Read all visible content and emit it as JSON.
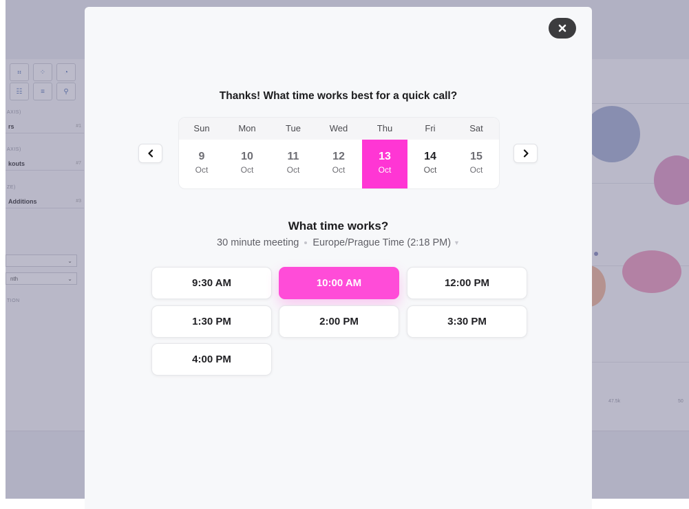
{
  "modal": {
    "close_icon": "close-icon",
    "prompt_title": "Thanks! What time works best for a quick call?",
    "calendar": {
      "prev_icon": "chevron-left-icon",
      "next_icon": "chevron-right-icon",
      "days": [
        {
          "dow": "Sun",
          "day": "9",
          "month": "Oct",
          "state": "unavailable"
        },
        {
          "dow": "Mon",
          "day": "10",
          "month": "Oct",
          "state": "unavailable"
        },
        {
          "dow": "Tue",
          "day": "11",
          "month": "Oct",
          "state": "unavailable"
        },
        {
          "dow": "Wed",
          "day": "12",
          "month": "Oct",
          "state": "unavailable"
        },
        {
          "dow": "Thu",
          "day": "13",
          "month": "Oct",
          "state": "selected"
        },
        {
          "dow": "Fri",
          "day": "14",
          "month": "Oct",
          "state": "available"
        },
        {
          "dow": "Sat",
          "day": "15",
          "month": "Oct",
          "state": "unavailable"
        }
      ]
    },
    "time_title": "What time works?",
    "meeting_length": "30 minute meeting",
    "timezone": "Europe/Prague Time (2:18 PM)",
    "time_slots": [
      "9:30 AM",
      "10:00 AM",
      "12:00 PM",
      "1:30 PM",
      "2:00 PM",
      "3:30 PM",
      "4:00 PM"
    ],
    "selected_slot": "10:00 AM",
    "accent_color": "#ff36d4"
  },
  "background": {
    "sidebar_fields": [
      {
        "label": "rs",
        "hotkey": "#1"
      },
      {
        "label": "kouts",
        "hotkey": "#7"
      },
      {
        "label": "Additions",
        "hotkey": "#3"
      }
    ],
    "sidebar_captions": [
      "AXIS)",
      "AXIS)",
      "ZE)",
      "TION"
    ],
    "select_value": "nth",
    "axis_ticks": [
      "47.5k",
      "50"
    ]
  }
}
